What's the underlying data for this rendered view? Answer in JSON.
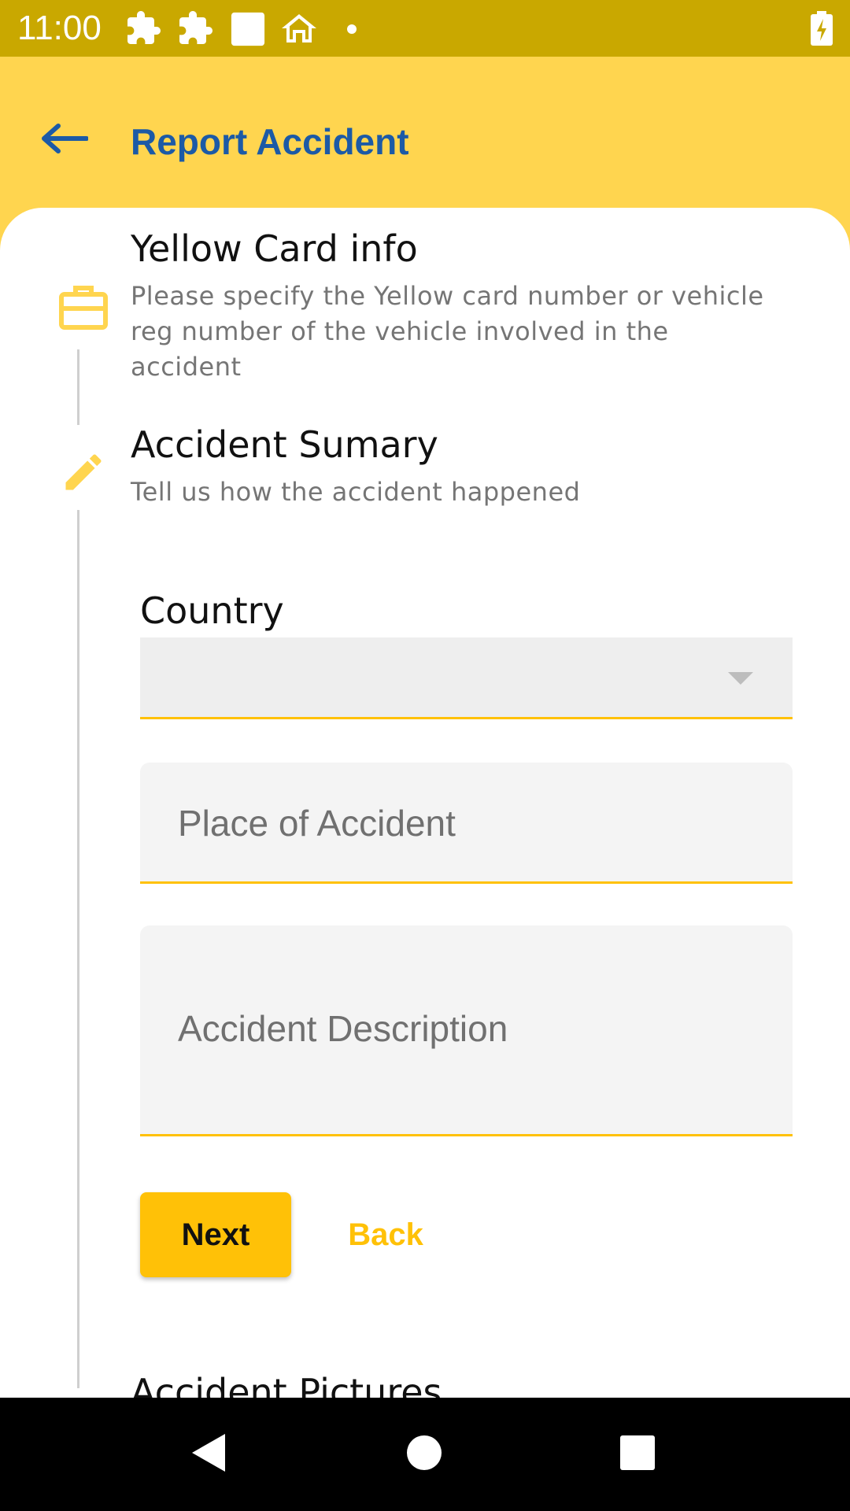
{
  "status_bar": {
    "time": "11:00",
    "icons": [
      "puzzle-icon",
      "puzzle-icon",
      "square-icon",
      "home-icon",
      "dot-icon"
    ],
    "battery": "battery-charging-icon",
    "color": "#C9A800"
  },
  "app_bar": {
    "title": "Report Accident",
    "back_icon": "arrow-left-icon",
    "title_color": "#1C5AA6",
    "background": "#FFD54F"
  },
  "steps": [
    {
      "icon": "briefcase-icon",
      "title": "Yellow Card info",
      "description": "Please specify the Yellow card number or vehicle reg number of the vehicle involved in the accident"
    },
    {
      "icon": "pencil-icon",
      "title": "Accident Sumary",
      "description": "Tell us how the accident happened"
    },
    {
      "icon": "",
      "title": "Accident Pictures",
      "description": ""
    }
  ],
  "form": {
    "country_label": "Country",
    "country_value": "",
    "place_placeholder": "Place of Accident",
    "description_placeholder": "Accident Description",
    "next_label": "Next",
    "back_label": "Back"
  },
  "colors": {
    "accent": "#FFC107",
    "icon_yellow": "#FFD54F"
  },
  "nav_bar": {
    "buttons": [
      "back-triangle-icon",
      "home-circle-icon",
      "recents-square-icon"
    ]
  }
}
